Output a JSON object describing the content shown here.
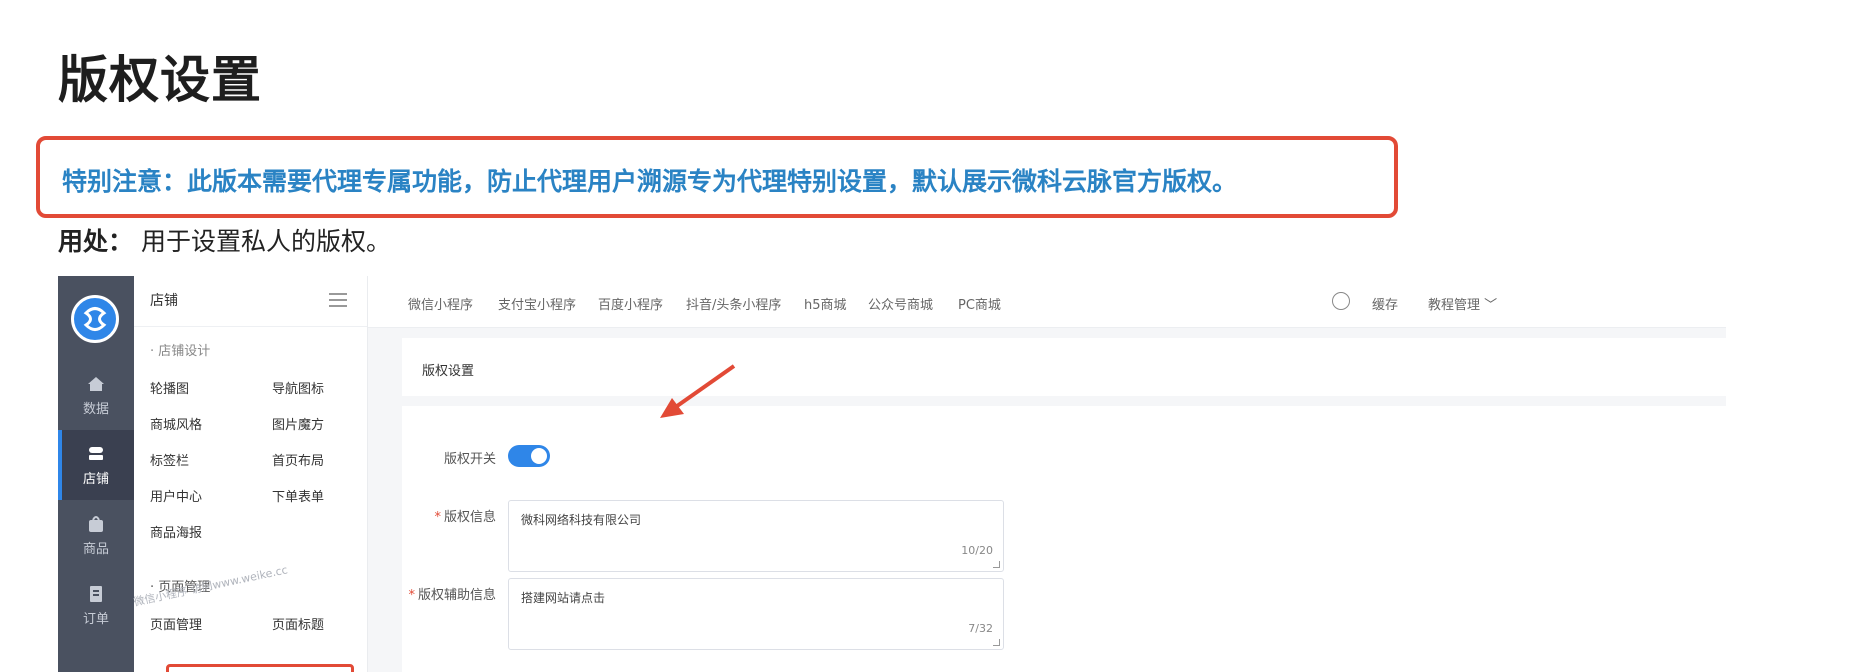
{
  "doc": {
    "title": "版权设置",
    "notice": "特别注意：此版本需要代理专属功能，防止代理用户溯源专为代理特别设置，默认展示微科云脉官方版权。",
    "usage_label": "用处：",
    "usage_text": " 用于设置私人的版权。"
  },
  "rail": {
    "items": [
      {
        "label": "数据",
        "icon": "home-icon"
      },
      {
        "label": "店铺",
        "icon": "store-icon"
      },
      {
        "label": "商品",
        "icon": "bag-icon"
      },
      {
        "label": "订单",
        "icon": "doc-icon"
      }
    ]
  },
  "menu": {
    "title": "店铺",
    "section1": "· 店铺设计",
    "links_col1": [
      "轮播图",
      "商城风格",
      "标签栏",
      "用户中心",
      "商品海报"
    ],
    "links_col2": [
      "导航图标",
      "图片魔方",
      "首页布局",
      "下单表单"
    ],
    "section2": "· 页面管理",
    "links2_col1": [
      "页面管理"
    ],
    "links2_col2": [
      "页面标题"
    ]
  },
  "topbar": {
    "tabs": [
      "微信小程序",
      "支付宝小程序",
      "百度小程序",
      "抖音/头条小程序",
      "h5商城",
      "公众号商城",
      "PC商城"
    ],
    "save": "缓存",
    "tutorial": "教程管理 ﹀"
  },
  "panel": {
    "title": "版权设置"
  },
  "form": {
    "switch_label": "版权开关",
    "switch_on": true,
    "info_label": "版权信息",
    "info_value": "微科网络科技有限公司",
    "info_count": "10/20",
    "aux_label": "版权辅助信息",
    "aux_value": "搭建网站请点击",
    "aux_count": "7/32"
  },
  "watermark": "微信小程序  访问www.weike.cc",
  "colors": {
    "accent": "#2f86e8",
    "notice_text": "#2a83c4",
    "highlight_red": "#e24a36",
    "rail_bg": "#4a5160"
  }
}
